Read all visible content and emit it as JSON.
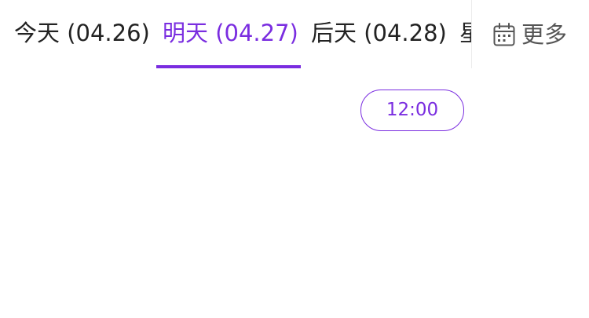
{
  "date_tabs": [
    {
      "label": "今天 (04.26)",
      "active": false
    },
    {
      "label": "明天 (04.27)",
      "active": true
    },
    {
      "label": "后天 (04.28)",
      "active": false
    },
    {
      "label": "星",
      "active": false
    }
  ],
  "more": {
    "label": "更多",
    "icon": "calendar-icon"
  },
  "time_slots": [
    {
      "label": "12:00"
    }
  ],
  "colors": {
    "accent": "#7a2de0",
    "text": "#222222",
    "muted": "#555555",
    "divider": "#ececec"
  }
}
